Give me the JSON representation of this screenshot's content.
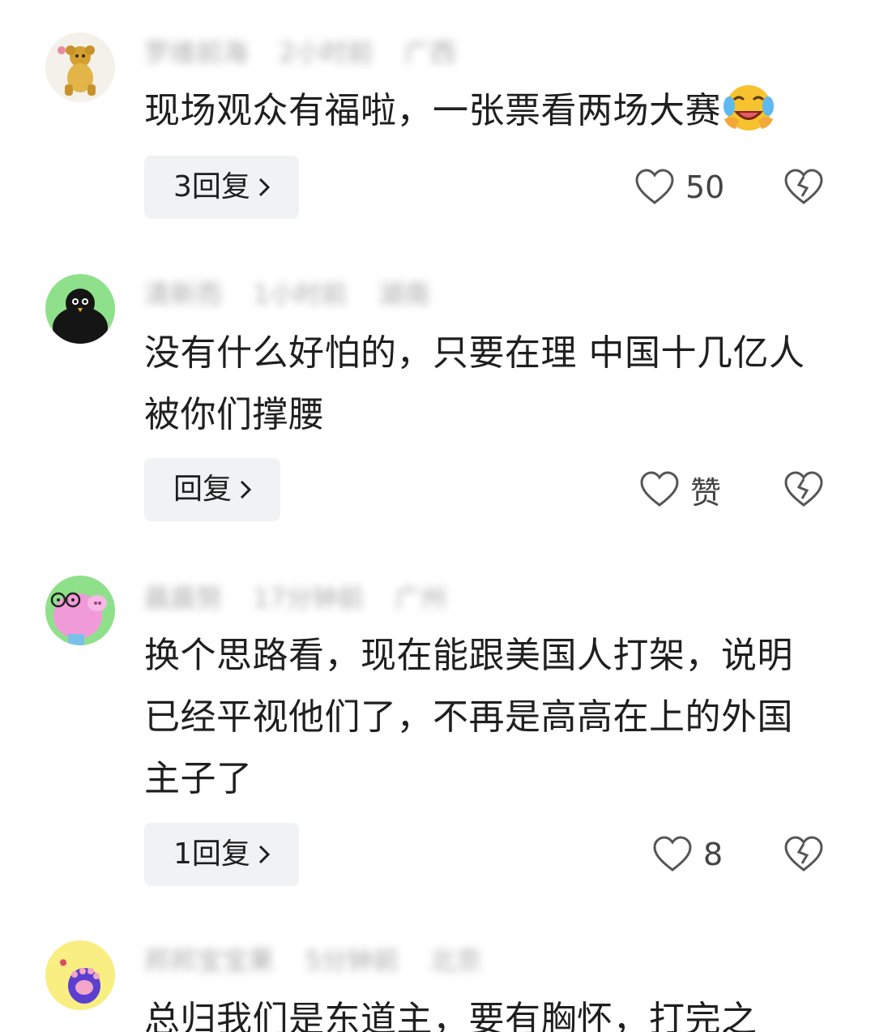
{
  "comments": [
    {
      "avatar_icon": "golden-monkey-avatar-icon",
      "meta": [
        "罗维前海",
        "2小时前",
        "广西"
      ],
      "text": "现场观众有福啦，一张票看两场大赛",
      "emoji": "laughing-crying-emoji",
      "reply_label": "3回复",
      "like_value": "50"
    },
    {
      "avatar_icon": "black-bird-avatar-icon",
      "meta": [
        "清新而",
        "1小时前",
        "湖南"
      ],
      "text": "没有什么好怕的，只要在理 中国十几亿人被你们撑腰",
      "reply_label": "回复",
      "like_value": "赞"
    },
    {
      "avatar_icon": "pink-pig-avatar-icon",
      "meta": [
        "晨晨努",
        "17分钟前",
        "广州"
      ],
      "text": "换个思路看，现在能跟美国人打架，说明已经平视他们了，不再是高高在上的外国主子了",
      "reply_label": "1回复",
      "like_value": "8"
    },
    {
      "avatar_icon": "purple-paw-avatar-icon",
      "meta": [
        "邦邦宝宝果",
        "5分钟前",
        "北京"
      ],
      "text": "总归我们是东道主，要有胸怀，打完之",
      "reply_label": "",
      "like_value": ""
    }
  ],
  "colors": {
    "reply_bg": "#f1f2f3",
    "meta_text": "#999999",
    "body_text": "#1f1f1f"
  }
}
